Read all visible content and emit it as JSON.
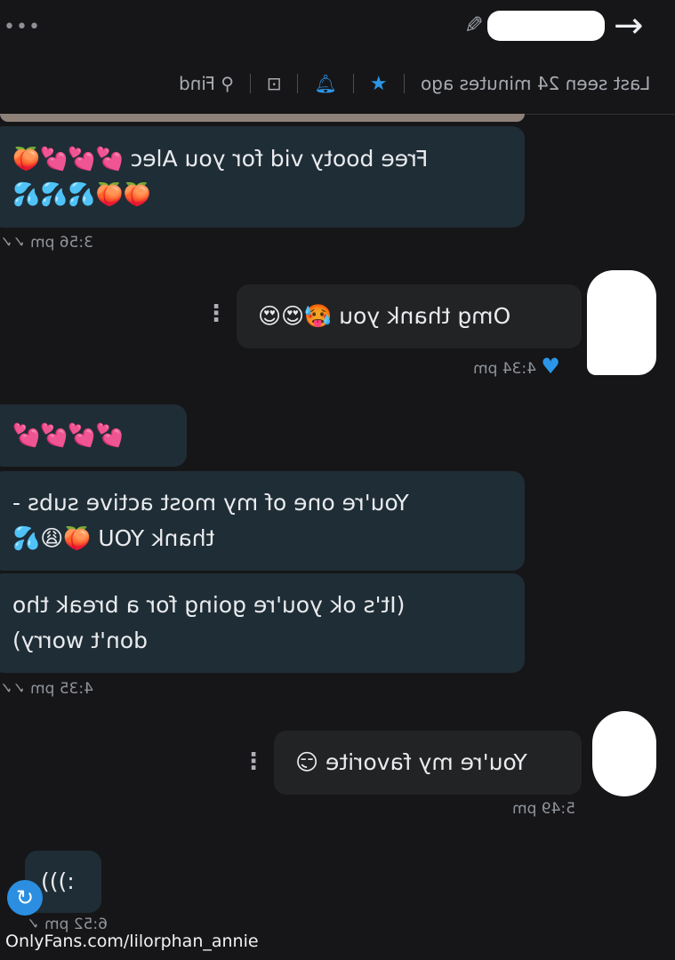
{
  "header": {
    "more_icon": "more-horizontal-icon",
    "edit_icon": "pencil-icon",
    "back_icon": "arrow-icon",
    "last_seen": "Last seen 24 minutes ago",
    "find_label": "Find",
    "icons": [
      "star-icon",
      "bell-icon",
      "media-icon",
      "search-icon"
    ],
    "accent": "#2b96e8"
  },
  "messages": [
    {
      "id": "m1",
      "lines": [
        "Free booty vid for you Alec 💕💕💕🍑",
        "🍑🍑💦💦💦"
      ],
      "time": "3:56 pm"
    },
    {
      "id": "m2",
      "lines": [
        "Omg thank you 🥵😍😍"
      ],
      "time": "4:34 pm"
    },
    {
      "id": "m3",
      "lines": [
        "💕💕💕💕"
      ]
    },
    {
      "id": "m4",
      "lines": [
        "You're one of my most active subs -",
        "thank YOU 🍑😩💦"
      ]
    },
    {
      "id": "m5",
      "lines": [
        "(It's ok you're going for a break tho",
        "don't worry)"
      ],
      "time": "4:35 pm"
    },
    {
      "id": "m6",
      "lines": [
        "You're my favorite 😏"
      ],
      "time": "5:49 pm"
    },
    {
      "id": "m7",
      "lines": [
        ":)))"
      ],
      "time": "6:52 pm"
    }
  ],
  "footer": {
    "watermark": "OnlyFans.com/lilorphan_annie"
  },
  "colors": {
    "incoming_bubble": "#1f2d36",
    "outgoing_bubble": "#222325",
    "background": "#161618",
    "read_heart": "#2b96e8"
  }
}
